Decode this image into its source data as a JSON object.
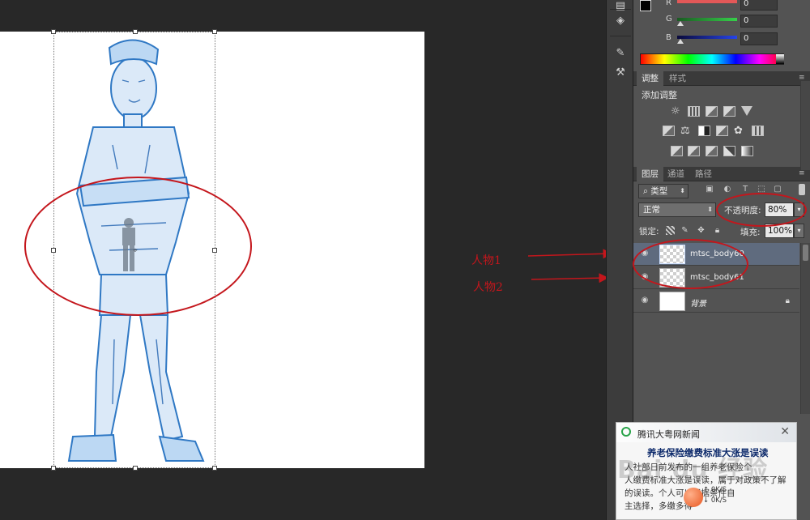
{
  "color_panel": {
    "channels": [
      {
        "label": "R",
        "value": "0",
        "track": "#e35858"
      },
      {
        "label": "G",
        "value": "0",
        "track": "#36b24a"
      },
      {
        "label": "B",
        "value": "0",
        "track": "#2644c9"
      }
    ]
  },
  "adjust_panel": {
    "tabs": [
      "调整",
      "样式"
    ],
    "title": "添加调整"
  },
  "layers_panel": {
    "tabs": [
      "图层",
      "通道",
      "路径"
    ],
    "filter_kind": "类型",
    "blend_mode": "正常",
    "opacity_label": "不透明度:",
    "opacity_value": "80%",
    "lock_label": "锁定:",
    "fill_label": "填充:",
    "fill_value": "100%",
    "layers": [
      {
        "name": "mtsc_body60",
        "selected": true
      },
      {
        "name": "mtsc_body61",
        "selected": false
      },
      {
        "name": "背景",
        "selected": false
      }
    ]
  },
  "annotations": {
    "person1": "人物1",
    "person2": "人物2",
    "color": "#c4161c"
  },
  "news_popup": {
    "source": "腾讯大粤网新闻",
    "title": "养老保险缴费标准大涨是误读",
    "line1": "人社部日前发布的一组养老保险个",
    "line2": "人缴费标准大涨是误读，属于对政策不了解",
    "line3": "的误读。个人可以根据条件自",
    "line4": "主选择，多缴多得",
    "speed_up": "0K/S",
    "speed_down": "0K/S",
    "watermark": "Bai du 经验"
  }
}
